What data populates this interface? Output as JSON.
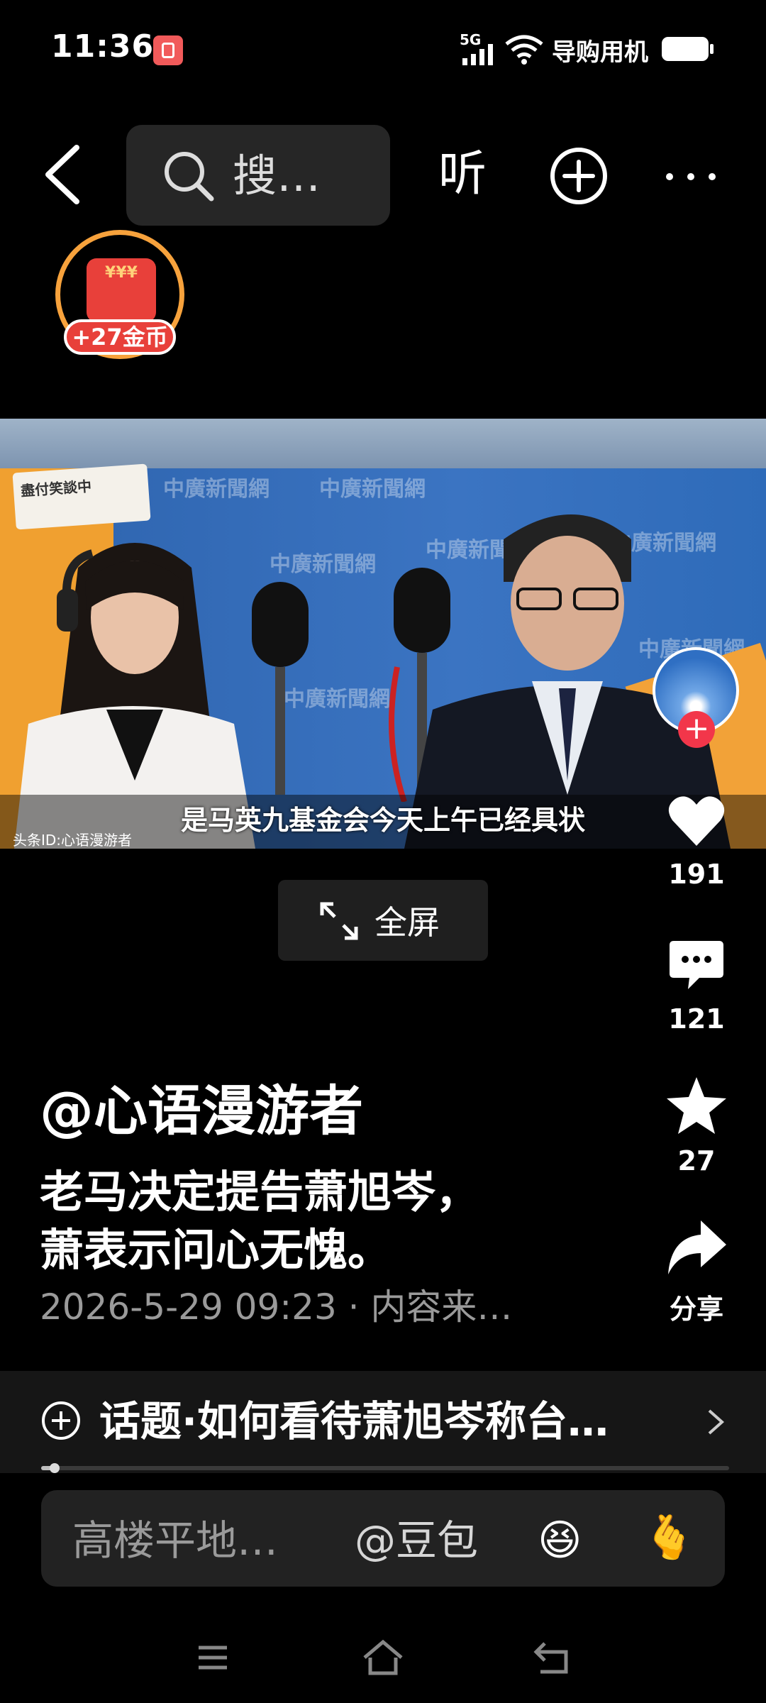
{
  "status_bar": {
    "time": "11:36",
    "network": "5G",
    "carrier": "导购用机"
  },
  "header": {
    "search_text": "搜…",
    "listen_label": "听"
  },
  "coin_badge": {
    "label": "+27金币"
  },
  "video": {
    "paper_text": "盡付笑談中",
    "subtitle": "是马英九基金会今天上午已经具状",
    "watermark": "头条ID:心语漫游者",
    "logo_text": "中廣新聞網"
  },
  "fullscreen": {
    "label": "全屏"
  },
  "actions": {
    "like_count": "191",
    "comment_count": "121",
    "favorite_count": "27",
    "share_label": "分享"
  },
  "post": {
    "username": "@心语漫游者",
    "description_line1": "老马决定提告萧旭岑，",
    "description_line2": "萧表示问心无愧。",
    "meta": "2026-5-29 09:23 · 内容来…"
  },
  "topic": {
    "text": "话题·如何看待萧旭岑称台…"
  },
  "progress": {
    "fraction": 0.02
  },
  "comment_bar": {
    "placeholder": "高楼平地…",
    "mention": "@豆包",
    "emoji_laugh": "😆",
    "emoji_heart": "🫰"
  },
  "colors": {
    "accent_red": "#f2364a",
    "coin_orange": "#f7a23c"
  }
}
